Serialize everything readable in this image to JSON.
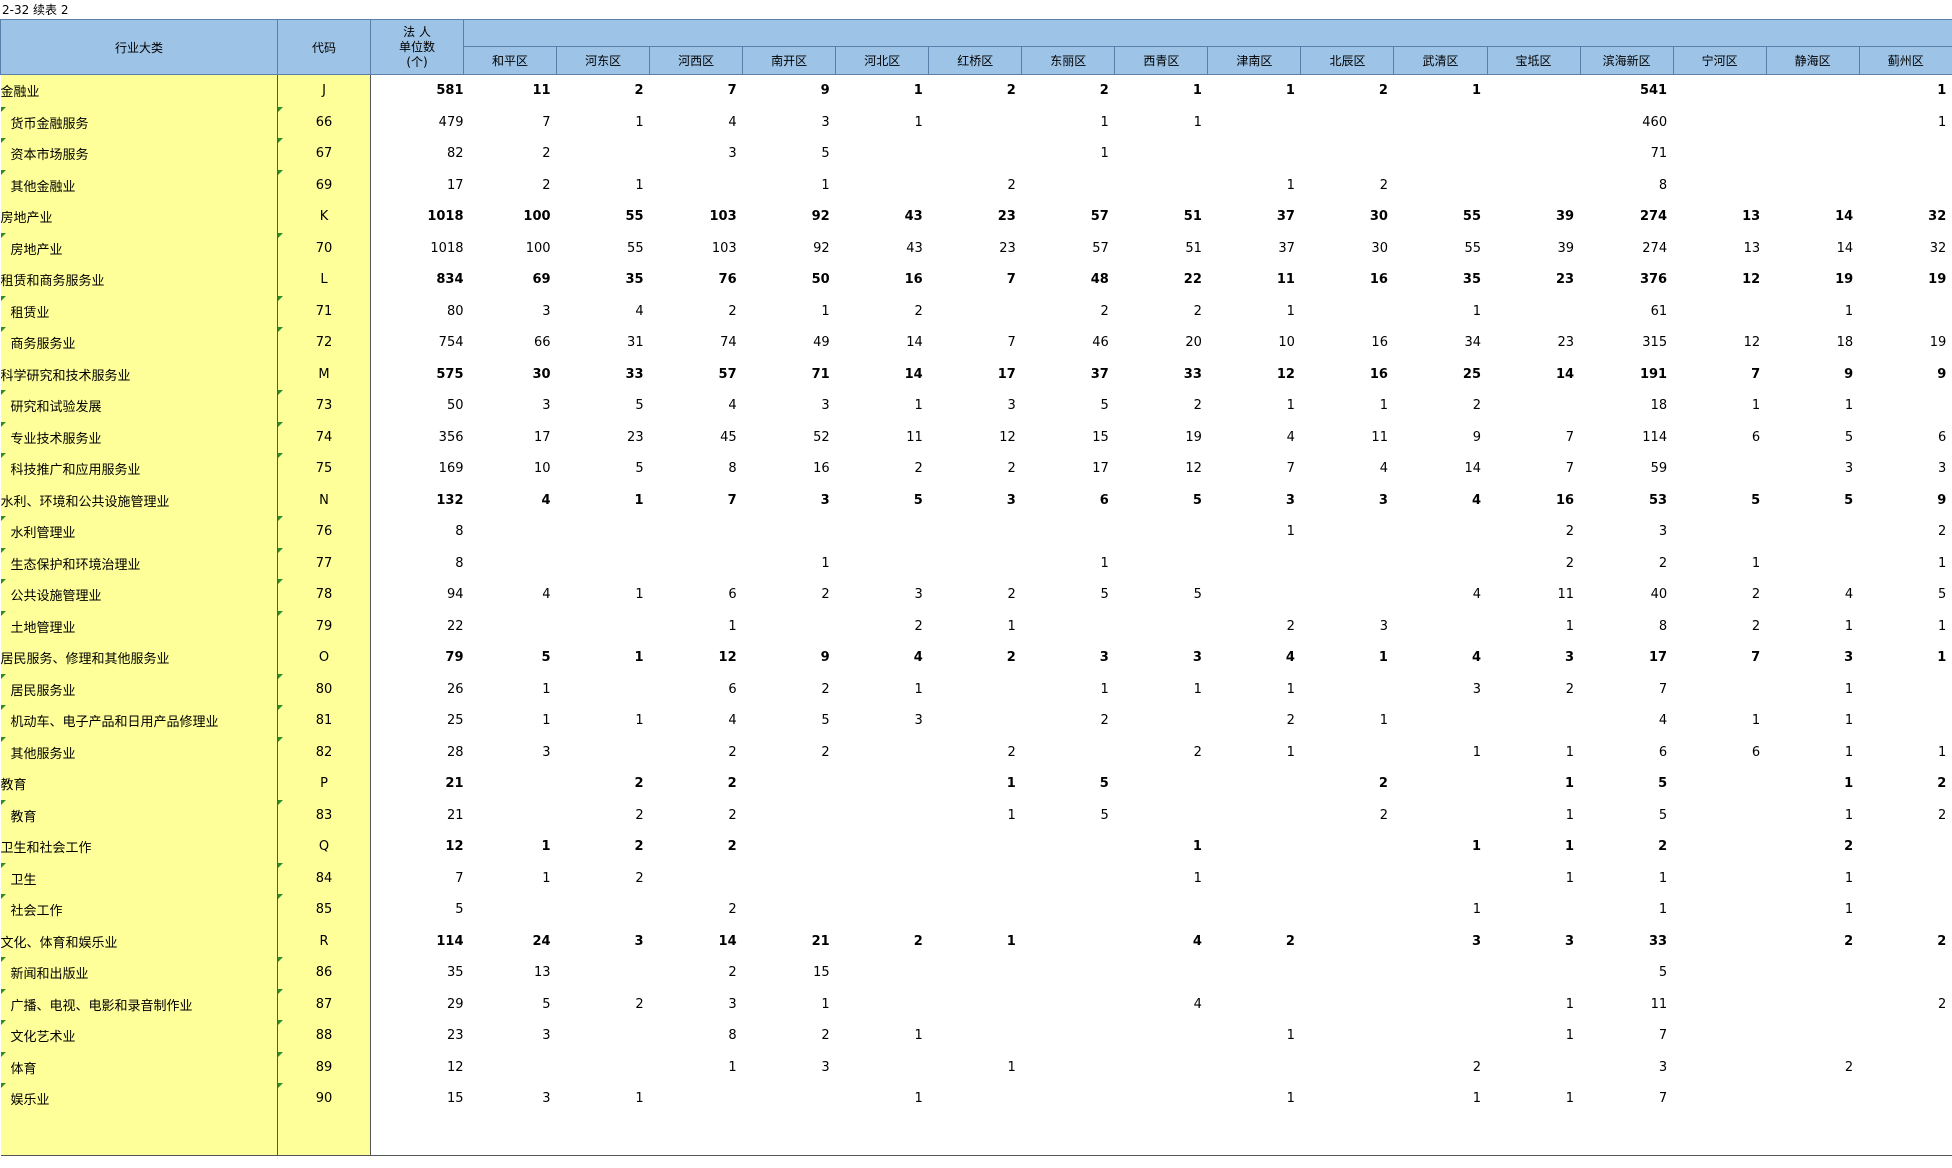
{
  "title": "2-32  续表 2",
  "header": {
    "industry": "行业大类",
    "code": "代码",
    "units_line1": "法  人",
    "units_line2": "单位数",
    "units_line3": "(个)",
    "districts": [
      "和平区",
      "河东区",
      "河西区",
      "南开区",
      "河北区",
      "红桥区",
      "东丽区",
      "西青区",
      "津南区",
      "北辰区",
      "武清区",
      "宝坻区",
      "滨海新区",
      "宁河区",
      "静海区",
      "蓟州区"
    ]
  },
  "rows": [
    {
      "name": "金融业",
      "code": "J",
      "bold": true,
      "values": [
        "581",
        "11",
        "2",
        "7",
        "9",
        "1",
        "2",
        "2",
        "1",
        "1",
        "2",
        "1",
        "",
        "541",
        "",
        "",
        "1"
      ]
    },
    {
      "name": "货币金融服务",
      "code": "66",
      "bold": false,
      "values": [
        "479",
        "7",
        "1",
        "4",
        "3",
        "1",
        "",
        "1",
        "1",
        "",
        "",
        "",
        "",
        "460",
        "",
        "",
        "1"
      ]
    },
    {
      "name": "资本市场服务",
      "code": "67",
      "bold": false,
      "values": [
        "82",
        "2",
        "",
        "3",
        "5",
        "",
        "",
        "1",
        "",
        "",
        "",
        "",
        "",
        "71",
        "",
        "",
        ""
      ]
    },
    {
      "name": "其他金融业",
      "code": "69",
      "bold": false,
      "values": [
        "17",
        "2",
        "1",
        "",
        "1",
        "",
        "2",
        "",
        "",
        "1",
        "2",
        "",
        "",
        "8",
        "",
        "",
        ""
      ]
    },
    {
      "name": "房地产业",
      "code": "K",
      "bold": true,
      "values": [
        "1018",
        "100",
        "55",
        "103",
        "92",
        "43",
        "23",
        "57",
        "51",
        "37",
        "30",
        "55",
        "39",
        "274",
        "13",
        "14",
        "32"
      ]
    },
    {
      "name": "房地产业",
      "code": "70",
      "bold": false,
      "values": [
        "1018",
        "100",
        "55",
        "103",
        "92",
        "43",
        "23",
        "57",
        "51",
        "37",
        "30",
        "55",
        "39",
        "274",
        "13",
        "14",
        "32"
      ]
    },
    {
      "name": "租赁和商务服务业",
      "code": "L",
      "bold": true,
      "values": [
        "834",
        "69",
        "35",
        "76",
        "50",
        "16",
        "7",
        "48",
        "22",
        "11",
        "16",
        "35",
        "23",
        "376",
        "12",
        "19",
        "19"
      ]
    },
    {
      "name": "租赁业",
      "code": "71",
      "bold": false,
      "values": [
        "80",
        "3",
        "4",
        "2",
        "1",
        "2",
        "",
        "2",
        "2",
        "1",
        "",
        "1",
        "",
        "61",
        "",
        "1",
        ""
      ]
    },
    {
      "name": "商务服务业",
      "code": "72",
      "bold": false,
      "values": [
        "754",
        "66",
        "31",
        "74",
        "49",
        "14",
        "7",
        "46",
        "20",
        "10",
        "16",
        "34",
        "23",
        "315",
        "12",
        "18",
        "19"
      ]
    },
    {
      "name": "科学研究和技术服务业",
      "code": "M",
      "bold": true,
      "values": [
        "575",
        "30",
        "33",
        "57",
        "71",
        "14",
        "17",
        "37",
        "33",
        "12",
        "16",
        "25",
        "14",
        "191",
        "7",
        "9",
        "9"
      ]
    },
    {
      "name": "研究和试验发展",
      "code": "73",
      "bold": false,
      "values": [
        "50",
        "3",
        "5",
        "4",
        "3",
        "1",
        "3",
        "5",
        "2",
        "1",
        "1",
        "2",
        "",
        "18",
        "1",
        "1",
        ""
      ]
    },
    {
      "name": "专业技术服务业",
      "code": "74",
      "bold": false,
      "values": [
        "356",
        "17",
        "23",
        "45",
        "52",
        "11",
        "12",
        "15",
        "19",
        "4",
        "11",
        "9",
        "7",
        "114",
        "6",
        "5",
        "6"
      ]
    },
    {
      "name": "科技推广和应用服务业",
      "code": "75",
      "bold": false,
      "values": [
        "169",
        "10",
        "5",
        "8",
        "16",
        "2",
        "2",
        "17",
        "12",
        "7",
        "4",
        "14",
        "7",
        "59",
        "",
        "3",
        "3"
      ]
    },
    {
      "name": "水利、环境和公共设施管理业",
      "code": "N",
      "bold": true,
      "values": [
        "132",
        "4",
        "1",
        "7",
        "3",
        "5",
        "3",
        "6",
        "5",
        "3",
        "3",
        "4",
        "16",
        "53",
        "5",
        "5",
        "9"
      ]
    },
    {
      "name": "水利管理业",
      "code": "76",
      "bold": false,
      "values": [
        "8",
        "",
        "",
        "",
        "",
        "",
        "",
        "",
        "",
        "1",
        "",
        "",
        "2",
        "3",
        "",
        "",
        "2"
      ]
    },
    {
      "name": "生态保护和环境治理业",
      "code": "77",
      "bold": false,
      "values": [
        "8",
        "",
        "",
        "",
        "1",
        "",
        "",
        "1",
        "",
        "",
        "",
        "",
        "2",
        "2",
        "1",
        "",
        "1"
      ]
    },
    {
      "name": "公共设施管理业",
      "code": "78",
      "bold": false,
      "values": [
        "94",
        "4",
        "1",
        "6",
        "2",
        "3",
        "2",
        "5",
        "5",
        "",
        "",
        "4",
        "11",
        "40",
        "2",
        "4",
        "5"
      ]
    },
    {
      "name": "土地管理业",
      "code": "79",
      "bold": false,
      "values": [
        "22",
        "",
        "",
        "1",
        "",
        "2",
        "1",
        "",
        "",
        "2",
        "3",
        "",
        "1",
        "8",
        "2",
        "1",
        "1"
      ]
    },
    {
      "name": "居民服务、修理和其他服务业",
      "code": "O",
      "bold": true,
      "values": [
        "79",
        "5",
        "1",
        "12",
        "9",
        "4",
        "2",
        "3",
        "3",
        "4",
        "1",
        "4",
        "3",
        "17",
        "7",
        "3",
        "1"
      ]
    },
    {
      "name": "居民服务业",
      "code": "80",
      "bold": false,
      "values": [
        "26",
        "1",
        "",
        "6",
        "2",
        "1",
        "",
        "1",
        "1",
        "1",
        "",
        "3",
        "2",
        "7",
        "",
        "1",
        ""
      ]
    },
    {
      "name": "机动车、电子产品和日用产品修理业",
      "code": "81",
      "bold": false,
      "values": [
        "25",
        "1",
        "1",
        "4",
        "5",
        "3",
        "",
        "2",
        "",
        "2",
        "1",
        "",
        "",
        "4",
        "1",
        "1",
        ""
      ]
    },
    {
      "name": "其他服务业",
      "code": "82",
      "bold": false,
      "values": [
        "28",
        "3",
        "",
        "2",
        "2",
        "",
        "2",
        "",
        "2",
        "1",
        "",
        "1",
        "1",
        "6",
        "6",
        "1",
        "1"
      ]
    },
    {
      "name": "教育",
      "code": "P",
      "bold": true,
      "values": [
        "21",
        "",
        "2",
        "2",
        "",
        "",
        "1",
        "5",
        "",
        "",
        "2",
        "",
        "1",
        "5",
        "",
        "1",
        "2"
      ]
    },
    {
      "name": "教育",
      "code": "83",
      "bold": false,
      "values": [
        "21",
        "",
        "2",
        "2",
        "",
        "",
        "1",
        "5",
        "",
        "",
        "2",
        "",
        "1",
        "5",
        "",
        "1",
        "2"
      ]
    },
    {
      "name": "卫生和社会工作",
      "code": "Q",
      "bold": true,
      "values": [
        "12",
        "1",
        "2",
        "2",
        "",
        "",
        "",
        "",
        "1",
        "",
        "",
        "1",
        "1",
        "2",
        "",
        "2",
        ""
      ]
    },
    {
      "name": "卫生",
      "code": "84",
      "bold": false,
      "values": [
        "7",
        "1",
        "2",
        "",
        "",
        "",
        "",
        "",
        "1",
        "",
        "",
        "",
        "1",
        "1",
        "",
        "1",
        ""
      ]
    },
    {
      "name": "社会工作",
      "code": "85",
      "bold": false,
      "values": [
        "5",
        "",
        "",
        "2",
        "",
        "",
        "",
        "",
        "",
        "",
        "",
        "1",
        "",
        "1",
        "",
        "1",
        ""
      ]
    },
    {
      "name": "文化、体育和娱乐业",
      "code": "R",
      "bold": true,
      "values": [
        "114",
        "24",
        "3",
        "14",
        "21",
        "2",
        "1",
        "",
        "4",
        "2",
        "",
        "3",
        "3",
        "33",
        "",
        "2",
        "2"
      ]
    },
    {
      "name": "新闻和出版业",
      "code": "86",
      "bold": false,
      "values": [
        "35",
        "13",
        "",
        "2",
        "15",
        "",
        "",
        "",
        "",
        "",
        "",
        "",
        "",
        "5",
        "",
        "",
        ""
      ]
    },
    {
      "name": "广播、电视、电影和录音制作业",
      "code": "87",
      "bold": false,
      "values": [
        "29",
        "5",
        "2",
        "3",
        "1",
        "",
        "",
        "",
        "4",
        "",
        "",
        "",
        "1",
        "11",
        "",
        "",
        "2"
      ]
    },
    {
      "name": "文化艺术业",
      "code": "88",
      "bold": false,
      "values": [
        "23",
        "3",
        "",
        "8",
        "2",
        "1",
        "",
        "",
        "",
        "1",
        "",
        "",
        "1",
        "7",
        "",
        "",
        ""
      ]
    },
    {
      "name": "体育",
      "code": "89",
      "bold": false,
      "values": [
        "12",
        "",
        "",
        "1",
        "3",
        "",
        "1",
        "",
        "",
        "",
        "",
        "2",
        "",
        "3",
        "",
        "2",
        ""
      ]
    },
    {
      "name": "娱乐业",
      "code": "90",
      "bold": false,
      "values": [
        "15",
        "3",
        "1",
        "",
        "",
        "1",
        "",
        "",
        "",
        "1",
        "",
        "1",
        "1",
        "7",
        "",
        "",
        ""
      ]
    }
  ]
}
